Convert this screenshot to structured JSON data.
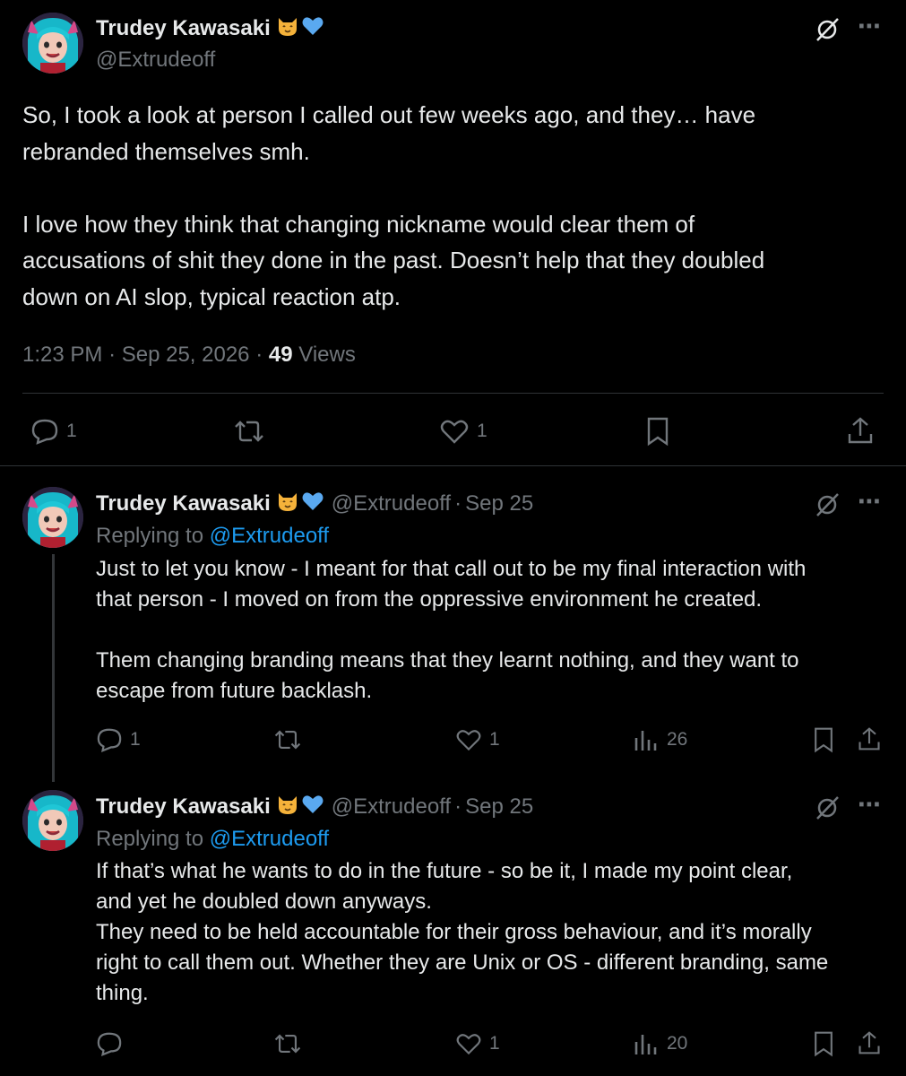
{
  "main_post": {
    "author_name": "Trudey Kawasaki",
    "author_handle": "@Extrudeoff",
    "body": "So, I took a look at person I called out few weeks ago, and they… have\nrebranded themselves smh.\n\nI love how they think that changing nickname would clear them of\naccusations of shit they done in the past. Doesn’t help that they doubled\ndown on AI slop, typical reaction atp.",
    "time": "1:23 PM",
    "date": "Sep 25, 2026",
    "views_count": "49",
    "views_label": "Views",
    "replies": "1",
    "likes": "1"
  },
  "replies": [
    {
      "author_name": "Trudey Kawasaki",
      "author_handle": "@Extrudeoff",
      "sep": "·",
      "date": "Sep 25",
      "replying_to_label": "Replying to",
      "replying_to_handle": "@Extrudeoff",
      "body": "Just to let you know - I meant for that call out to be my final interaction with\nthat person - I moved on from the oppressive environment he created.\n\nThem changing branding means that they learnt nothing, and they want to\nescape from future backlash.",
      "replies": "1",
      "likes": "1",
      "views": "26"
    },
    {
      "author_name": "Trudey Kawasaki",
      "author_handle": "@Extrudeoff",
      "sep": "·",
      "date": "Sep 25",
      "replying_to_label": "Replying to",
      "replying_to_handle": "@Extrudeoff",
      "body": "If that’s what he wants to do in the future - so be it, I made my point clear,\nand yet he doubled down anyways.\nThey need to be held accountable for their gross behaviour, and it’s morally\nright to call them out. Whether they are Unix or OS - different branding, same\nthing.",
      "replies": "",
      "likes": "1",
      "views": "20"
    }
  ],
  "icons": {
    "more": "⋯",
    "badge_cat": "cat-face-icon",
    "badge_heart": "blue-heart-icon",
    "grok": "grok-icon"
  },
  "colors": {
    "background": "#000000",
    "text": "#e7e9ea",
    "muted": "#71767b",
    "link": "#1d9bf0",
    "heart": "#5aa9f0"
  }
}
